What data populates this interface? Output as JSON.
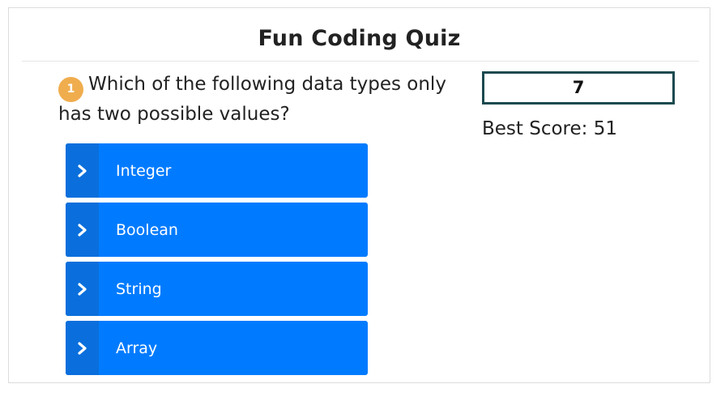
{
  "quiz": {
    "title": "Fun Coding Quiz",
    "question_number": "1",
    "question_text": "Which of the following data types only has two possible values?",
    "answers": [
      {
        "label": "Integer"
      },
      {
        "label": "Boolean"
      },
      {
        "label": "String"
      },
      {
        "label": "Array"
      }
    ],
    "score": "7",
    "best_score_label": "Best Score: 51"
  },
  "colors": {
    "answer_button": "#007bff",
    "answer_chevron_strip": "#0a6fdc",
    "badge": "#f0ad4e",
    "score_border": "#1c4a4f"
  },
  "icons": {
    "answer_icon": "chevron-right-icon"
  }
}
